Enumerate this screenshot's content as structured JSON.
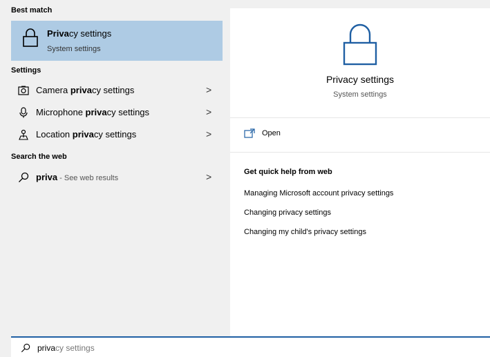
{
  "left": {
    "best_match_heading": "Best match",
    "best_match": {
      "title_bold": "Priva",
      "title_rest": "cy settings",
      "subtitle": "System settings",
      "icon": "lock-icon"
    },
    "settings_heading": "Settings",
    "settings_items": [
      {
        "icon": "camera-icon",
        "pre": "Camera ",
        "bold": "priva",
        "post": "cy settings"
      },
      {
        "icon": "microphone-icon",
        "pre": "Microphone ",
        "bold": "priva",
        "post": "cy settings"
      },
      {
        "icon": "location-icon",
        "pre": "Location ",
        "bold": "priva",
        "post": "cy settings"
      }
    ],
    "web_heading": "Search the web",
    "web_item": {
      "icon": "search-icon",
      "bold": "priva",
      "post": " - See web results"
    }
  },
  "right": {
    "title": "Privacy settings",
    "subtitle": "System settings",
    "open_label": "Open",
    "help_title": "Get quick help from web",
    "help_links": [
      "Managing Microsoft account privacy settings",
      "Changing privacy settings",
      "Changing my child's privacy settings"
    ]
  },
  "search": {
    "typed": "priva",
    "completion": "cy settings",
    "icon": "search-icon"
  },
  "colors": {
    "selected_bg": "#aecbe4",
    "accent": "#1f5fa3"
  }
}
